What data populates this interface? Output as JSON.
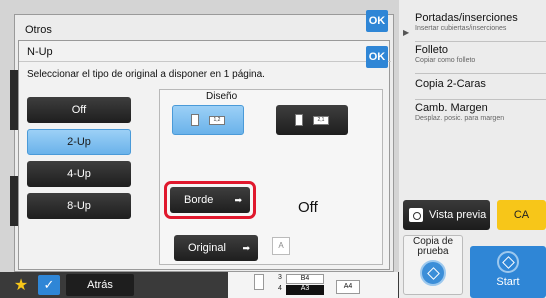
{
  "right_panel": {
    "items": [
      {
        "title": "Portadas/inserciones",
        "subtitle": "Insertar cubiertas/inserciones"
      },
      {
        "title": "Folleto",
        "subtitle": "Copiar como folleto"
      },
      {
        "title": "Copia 2-Caras",
        "subtitle": ""
      },
      {
        "title": "Camb. Margen",
        "subtitle": "Desplaz. posic. para margen"
      }
    ],
    "preview_label": "Vista previa",
    "ca_label": "CA",
    "proof_label": "Copia de prueba",
    "start_label": "Start"
  },
  "otros": {
    "title": "Otros",
    "ok_label": "OK"
  },
  "nup": {
    "title": "N-Up",
    "ok_label": "OK",
    "description": "Seleccionar el tipo de original a disponer en 1 página.",
    "options": [
      "Off",
      "2-Up",
      "4-Up",
      "8-Up"
    ],
    "selected": "2-Up",
    "layout_label": "Diseño",
    "layout_a": "1,2",
    "layout_b": "2,1",
    "borde_label": "Borde",
    "borde_value": "Off",
    "original_label": "Original",
    "original_icon_text": "A"
  },
  "bottom": {
    "back_label": "Atrás",
    "num_top": "3",
    "num_bottom": "4",
    "tray_top": "B4",
    "tray_bottom": "A3",
    "paper_right": "A4"
  },
  "colors": {
    "accent": "#2f86d6",
    "ca": "#f7c619",
    "highlight": "#e0182d"
  }
}
